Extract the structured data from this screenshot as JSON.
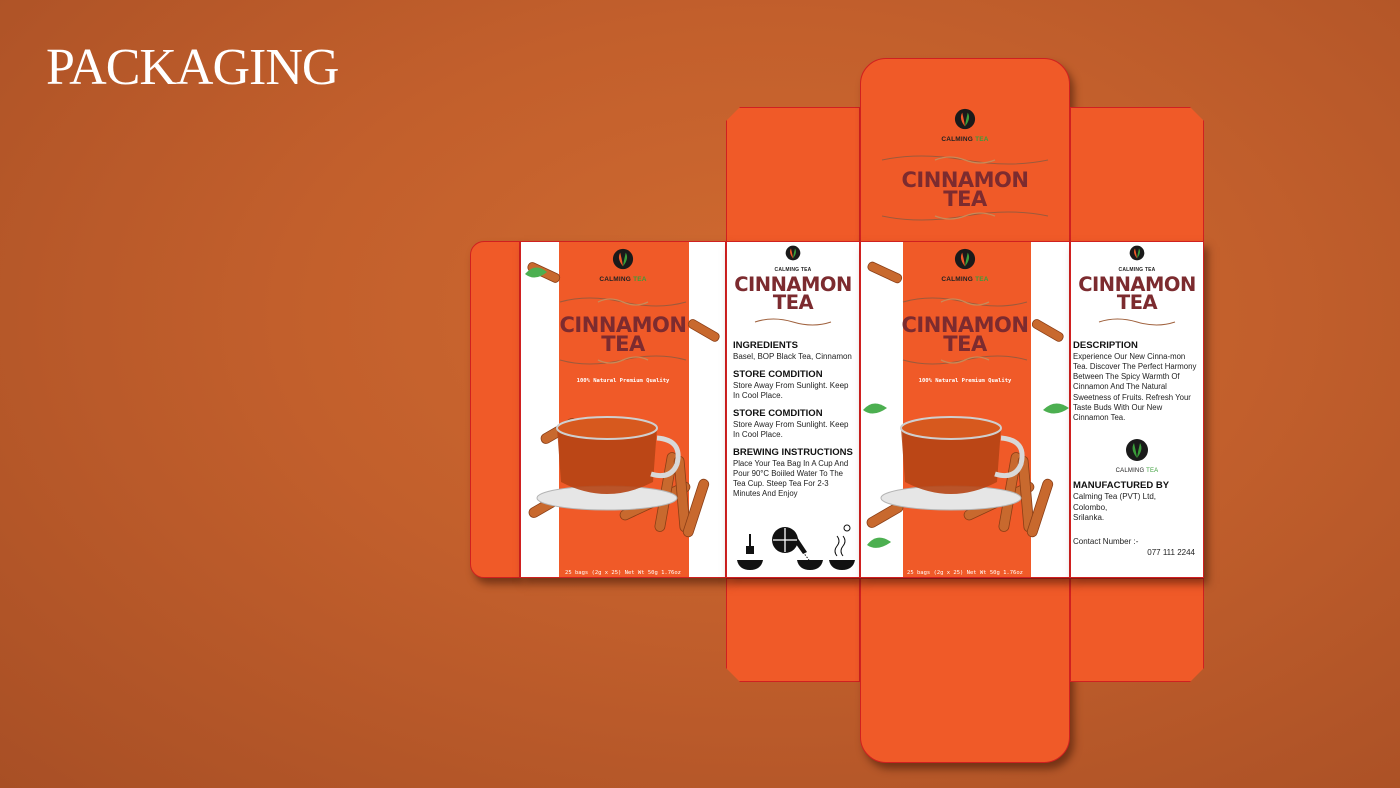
{
  "page": {
    "heading": "PACKAGING"
  },
  "brand": {
    "name_main": "CALMING",
    "name_accent": "TEA",
    "accent_color": "#3a9d3a"
  },
  "product": {
    "title_line1": "CINNAMON",
    "title_line2": "TEA",
    "tagline": "100% Natural Premium Quality",
    "net_weight": "25 bags (2g x 25) Net Wt 50g 1.76oz"
  },
  "side_panel": {
    "sections": [
      {
        "heading": "INGREDIENTS",
        "body": "Basel, BOP Black Tea, Cinnamon"
      },
      {
        "heading": "STORE COMDITION",
        "body": "Store Away From Sunlight. Keep In Cool Place."
      },
      {
        "heading": "STORE COMDITION",
        "body": "Store Away From Sunlight. Keep In Cool Place."
      },
      {
        "heading": "BREWING INSTRUCTIONS",
        "body": "Place Your Tea Bag In A Cup And Pour 90°C Boiiled Water To The Tea Cup. Steep Tea For 2-3 Minutes And Enjoy"
      }
    ]
  },
  "back_panel": {
    "description_heading": "DESCRIPTION",
    "description_body": "Experience Our New Cinna-mon Tea. Discover The Perfect Harmony Between The Spicy Warmth Of Cinnamon And The Natural Sweetness of Fruits. Refresh Your Taste Buds With Our New Cinnamon Tea.",
    "manufacturer_heading": "MANUFACTURED BY",
    "manufacturer_line1": "Calming Tea (PVT) Ltd,",
    "manufacturer_line2": "Colombo,",
    "manufacturer_line3": "Srilanka.",
    "contact_label": "Contact Number :-",
    "contact_number": "077 111 2244"
  },
  "colors": {
    "box_orange": "#f05a28",
    "title_maroon": "#7c2b2f",
    "background": "#c25f2c"
  }
}
